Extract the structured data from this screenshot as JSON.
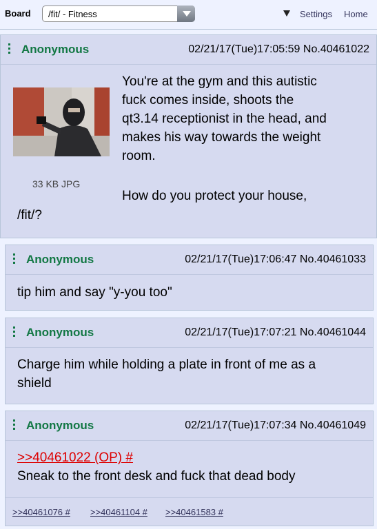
{
  "topbar": {
    "board_label": "Board",
    "board_value": "/fit/ - Fitness",
    "settings": "Settings",
    "home": "Home"
  },
  "posts": [
    {
      "name": "Anonymous",
      "datetime": "02/21/17(Tue)17:05:59",
      "number": "No.40461022",
      "file_info": "33 KB JPG",
      "text_lines": [
        "You're at the gym and this autistic",
        "fuck comes inside, shoots the",
        "qt3.14 receptionist in the head, and",
        "makes his way towards the weight",
        "room."
      ],
      "text2_line1": "How do you protect your house,",
      "text2_line2": "/fit/?"
    },
    {
      "name": "Anonymous",
      "datetime": "02/21/17(Tue)17:06:47",
      "number": "No.40461033",
      "text": "tip him and say \"y-you too\""
    },
    {
      "name": "Anonymous",
      "datetime": "02/21/17(Tue)17:07:21",
      "number": "No.40461044",
      "text_lines": [
        "Charge him while holding a plate in front of me as a",
        "shield"
      ]
    },
    {
      "name": "Anonymous",
      "datetime": "02/21/17(Tue)17:07:34",
      "number": "No.40461049",
      "quote": ">>40461022 (OP) #",
      "text": "Sneak to the front desk and fuck that dead body",
      "backlinks": [
        ">>40461076 #",
        ">>40461104 #",
        ">>40461583 #"
      ]
    }
  ]
}
